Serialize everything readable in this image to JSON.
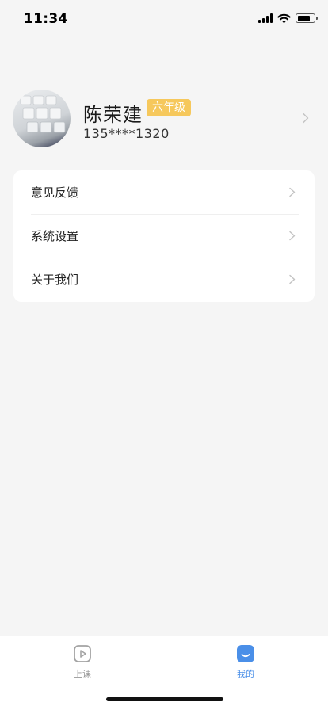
{
  "status_bar": {
    "time": "11:34",
    "icons": [
      "signal-icon",
      "wifi-icon",
      "battery-icon"
    ]
  },
  "profile": {
    "name": "陈荣建",
    "grade": "六年级",
    "phone": "135****1320",
    "badge_color": "#f6c85c"
  },
  "menu": {
    "items": [
      {
        "label": "意见反馈"
      },
      {
        "label": "系统设置"
      },
      {
        "label": "关于我们"
      }
    ]
  },
  "tab_bar": {
    "tabs": [
      {
        "label": "上课",
        "icon": "play-icon",
        "active": false
      },
      {
        "label": "我的",
        "icon": "smile-icon",
        "active": true
      }
    ],
    "active_color": "#4a8fe8",
    "inactive_color": "#999999"
  }
}
